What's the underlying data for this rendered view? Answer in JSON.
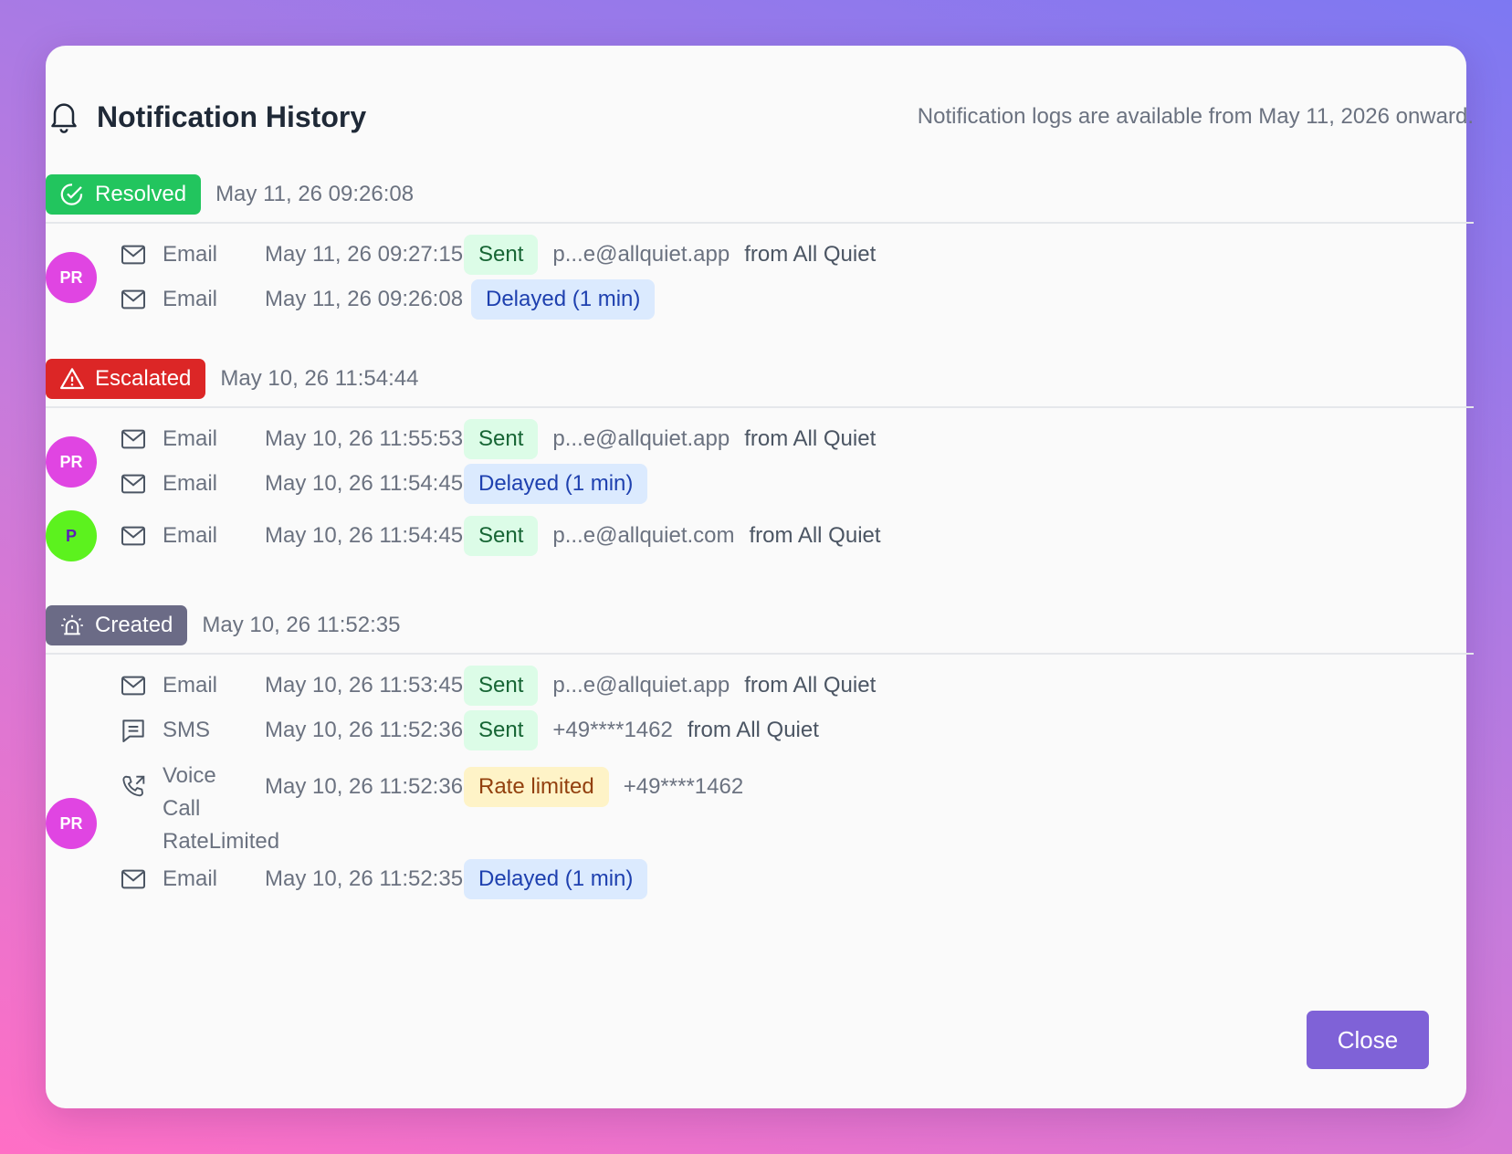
{
  "header": {
    "title": "Notification History",
    "note": "Notification logs are available from May 11, 2026 onward."
  },
  "colors": {
    "accent": "#7f62d7",
    "resolved": "#22c55e",
    "escalated": "#dc2626",
    "created": "#6b6b86",
    "sent_bg": "#dcfce7",
    "delayed_bg": "#dbeafe",
    "rate_bg": "#fef3c7"
  },
  "sections": [
    {
      "status": "Resolved",
      "icon": "check-circle-icon",
      "time": "May 11, 26 09:26:08",
      "groups": [
        {
          "avatar": "PR",
          "rows": [
            {
              "channel": "Email",
              "icon": "mail-icon",
              "time": "May 11, 26 09:27:15",
              "state": "Sent",
              "target": "p...e@allquiet.app",
              "from": "from All Quiet"
            },
            {
              "channel": "Email",
              "icon": "mail-icon",
              "time": "May 11, 26 09:26:08",
              "state": "Delayed (1 min)"
            }
          ]
        }
      ]
    },
    {
      "status": "Escalated",
      "icon": "warning-triangle-icon",
      "time": "May 10, 26 11:54:44",
      "groups": [
        {
          "avatar": "PR",
          "rows": [
            {
              "channel": "Email",
              "icon": "mail-icon",
              "time": "May 10, 26 11:55:53",
              "state": "Sent",
              "target": "p...e@allquiet.app",
              "from": "from All Quiet"
            },
            {
              "channel": "Email",
              "icon": "mail-icon",
              "time": "May 10, 26 11:54:45",
              "state": "Delayed (1 min)"
            }
          ]
        },
        {
          "avatar": "P",
          "rows": [
            {
              "channel": "Email",
              "icon": "mail-icon",
              "time": "May 10, 26 11:54:45",
              "state": "Sent",
              "target": "p...e@allquiet.com",
              "from": "from All Quiet"
            }
          ]
        }
      ]
    },
    {
      "status": "Created",
      "icon": "siren-icon",
      "time": "May 10, 26 11:52:35",
      "groups": [
        {
          "avatar": "PR",
          "rows": [
            {
              "channel": "Email",
              "icon": "mail-icon",
              "time": "May 10, 26 11:53:45",
              "state": "Sent",
              "target": "p...e@allquiet.app",
              "from": "from All Quiet"
            },
            {
              "channel": "SMS",
              "icon": "message-icon",
              "time": "May 10, 26 11:52:36",
              "state": "Sent",
              "target": "+49****1462",
              "from": "from All Quiet"
            },
            {
              "channel_line1": "Voice",
              "channel_line2": "Call",
              "channel_line3": "RateLimited",
              "icon": "phone-outgoing-icon",
              "time": "May 10, 26 11:52:36",
              "state": "Rate limited",
              "target": "+49****1462"
            },
            {
              "channel": "Email",
              "icon": "mail-icon",
              "time": "May 10, 26 11:52:35",
              "state": "Delayed (1 min)"
            }
          ]
        }
      ]
    }
  ],
  "close_label": "Close"
}
